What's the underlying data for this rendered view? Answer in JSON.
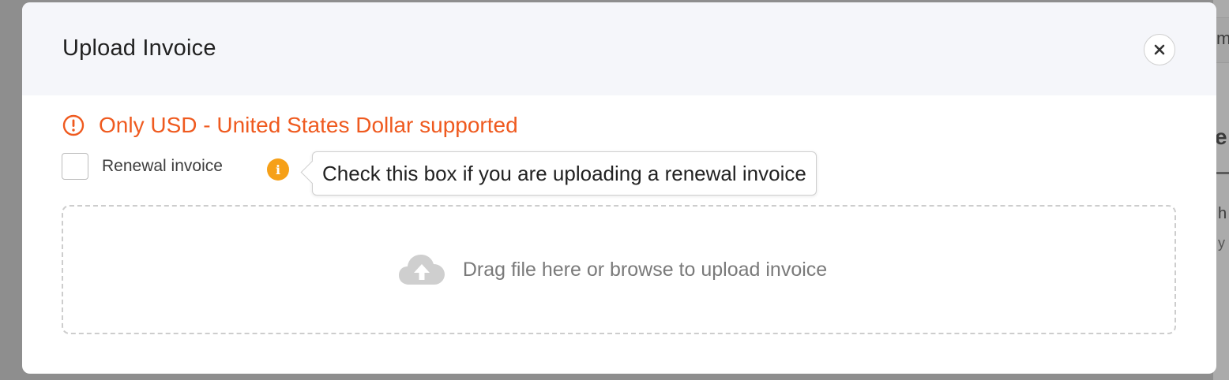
{
  "background": {
    "fragment_1": "m",
    "fragment_2": "e",
    "fragment_3": "h",
    "fragment_4": "y"
  },
  "modal": {
    "title": "Upload Invoice",
    "close_icon": "close-icon",
    "warning": {
      "icon": "exclamation-circle-icon",
      "text": "Only USD - United States Dollar supported",
      "color": "#ef5a1f"
    },
    "renewal": {
      "checked": false,
      "label": "Renewal invoice",
      "info_icon": "info-icon",
      "tooltip": "Check this box if you are uploading a renewal invoice"
    },
    "dropzone": {
      "icon": "cloud-upload-icon",
      "text": "Drag file here or browse to upload invoice"
    }
  }
}
